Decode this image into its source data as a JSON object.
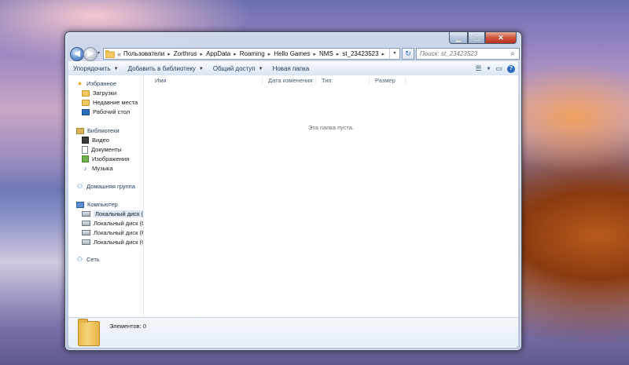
{
  "window": {
    "caption_buttons": {
      "minimize": "▁",
      "maximize": "▢",
      "close": "✕"
    }
  },
  "nav": {
    "back_icon": "back-arrow-icon",
    "back_glyph": "◀",
    "forward_glyph": "▶",
    "history_glyph": "▾",
    "raquo": "«",
    "breadcrumbs": [
      "Пользователи",
      "Zorthrus",
      "AppData",
      "Roaming",
      "Hello Games",
      "NMS",
      "st_23423523"
    ],
    "separator": "▸",
    "dropdown_glyph": "▾",
    "refresh_glyph": "↻",
    "search_placeholder": "Поиск: st_23423523",
    "search_glyph": "⌕"
  },
  "toolbar": {
    "organize": "Упорядочить",
    "add_to_library": "Добавить в библиотеку",
    "share": "Общий доступ",
    "new_folder": "Новая папка",
    "arrow": "▼",
    "views_glyph": "☰",
    "views_arrow": "▼",
    "preview_glyph": "▭",
    "help_glyph": "?"
  },
  "sidebar": {
    "favorites": {
      "label": "Избранное",
      "items": [
        "Загрузки",
        "Недавние места",
        "Рабочий стол"
      ]
    },
    "libraries": {
      "label": "Библиотеки",
      "items": [
        "Видео",
        "Документы",
        "Изображения",
        "Музыка"
      ]
    },
    "homegroup": {
      "label": "Домашняя группа"
    },
    "computer": {
      "label": "Компьютер",
      "items": [
        "Локальный диск (C:)",
        "Локальный диск (D:)",
        "Локальный диск (F:)",
        "Локальный диск (G:)"
      ]
    },
    "network": {
      "label": "Сеть"
    },
    "icons": {
      "star": "★",
      "music": "♪",
      "group": "⚇",
      "network": "⚇"
    }
  },
  "columns": {
    "name": "Имя",
    "date": "Дата изменения",
    "type": "Тип",
    "size": "Размер"
  },
  "empty_message": "Эта папка пуста.",
  "status": {
    "count_text": "Элементов: 0"
  },
  "colors": {
    "accent": "#2a6bbd",
    "selected": "#dde8f6"
  }
}
